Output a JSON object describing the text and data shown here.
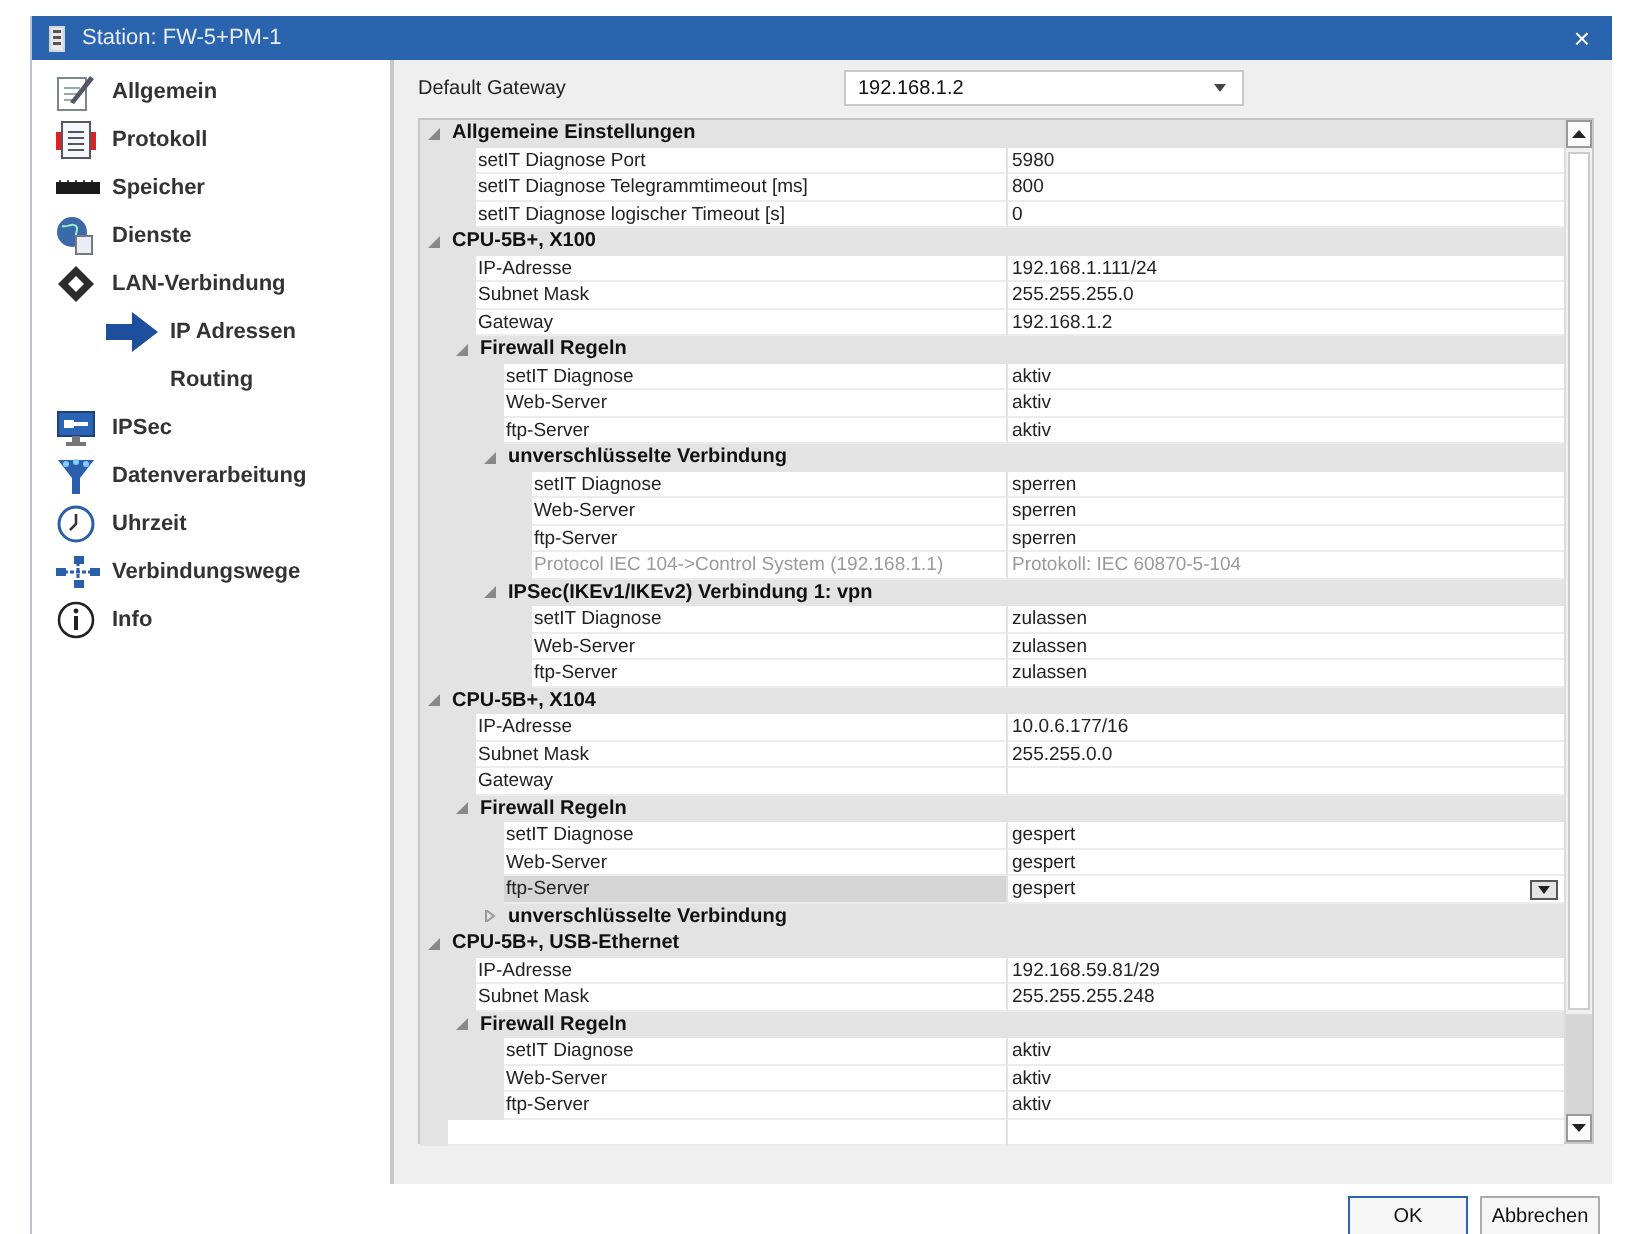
{
  "window": {
    "title": "Station: FW-5+PM-1",
    "close": "×"
  },
  "sidebar": {
    "items": [
      {
        "label": "Allgemein",
        "selected": false
      },
      {
        "label": "Protokoll",
        "selected": false
      },
      {
        "label": "Speicher",
        "selected": false
      },
      {
        "label": "Dienste",
        "selected": false
      },
      {
        "label": "LAN-Verbindung",
        "selected": false,
        "children": [
          {
            "label": "IP Adressen",
            "selected": true
          },
          {
            "label": "Routing",
            "selected": false
          }
        ]
      },
      {
        "label": "IPSec",
        "selected": false
      },
      {
        "label": "Datenverarbeitung",
        "selected": false
      },
      {
        "label": "Uhrzeit",
        "selected": false
      },
      {
        "label": "Verbindungswege",
        "selected": false
      },
      {
        "label": "Info",
        "selected": false
      }
    ]
  },
  "default_gateway": {
    "label": "Default Gateway",
    "value": "192.168.1.2"
  },
  "grid": {
    "groups": [
      {
        "title": "Allgemeine Einstellungen",
        "expanded": true,
        "children": [
          {
            "label": "setIT Diagnose Port",
            "value": "5980"
          },
          {
            "label": "setIT Diagnose Telegrammtimeout [ms]",
            "value": "800"
          },
          {
            "label": "setIT Diagnose logischer Timeout [s]",
            "value": "0"
          }
        ]
      },
      {
        "title": "CPU-5B+, X100",
        "expanded": true,
        "children": [
          {
            "label": "IP-Adresse",
            "value": "192.168.1.111/24"
          },
          {
            "label": "Subnet Mask",
            "value": "255.255.255.0"
          },
          {
            "label": "Gateway",
            "value": "192.168.1.2"
          },
          {
            "title": "Firewall Regeln",
            "expanded": true,
            "children": [
              {
                "label": "setIT Diagnose",
                "value": "aktiv"
              },
              {
                "label": "Web-Server",
                "value": "aktiv"
              },
              {
                "label": "ftp-Server",
                "value": "aktiv"
              },
              {
                "title": "unverschlüsselte Verbindung",
                "expanded": true,
                "children": [
                  {
                    "label": "setIT Diagnose",
                    "value": "sperren"
                  },
                  {
                    "label": "Web-Server",
                    "value": "sperren"
                  },
                  {
                    "label": "ftp-Server",
                    "value": "sperren"
                  },
                  {
                    "label": "Protocol IEC 104->Control System (192.168.1.1)",
                    "value": "Protokoll: IEC 60870-5-104",
                    "disabled": true
                  }
                ]
              },
              {
                "title": "IPSec(IKEv1/IKEv2) Verbindung 1: vpn",
                "expanded": true,
                "children": [
                  {
                    "label": "setIT Diagnose",
                    "value": "zulassen"
                  },
                  {
                    "label": "Web-Server",
                    "value": "zulassen"
                  },
                  {
                    "label": "ftp-Server",
                    "value": "zulassen"
                  }
                ]
              }
            ]
          }
        ]
      },
      {
        "title": "CPU-5B+, X104",
        "expanded": true,
        "children": [
          {
            "label": "IP-Adresse",
            "value": "10.0.6.177/16"
          },
          {
            "label": "Subnet Mask",
            "value": "255.255.0.0"
          },
          {
            "label": "Gateway"
          },
          {
            "title": "Firewall Regeln",
            "expanded": true,
            "children": [
              {
                "label": "setIT Diagnose",
                "value": "gespert"
              },
              {
                "label": "Web-Server",
                "value": "gespert"
              },
              {
                "label": "ftp-Server",
                "value": "gespert",
                "selected": true
              },
              {
                "title": "unverschlüsselte Verbindung",
                "expanded": false
              }
            ]
          }
        ]
      },
      {
        "title": "CPU-5B+, USB-Ethernet",
        "expanded": true,
        "children": [
          {
            "label": "IP-Adresse",
            "value": "192.168.59.81/29"
          },
          {
            "label": "Subnet Mask",
            "value": "255.255.255.248"
          },
          {
            "title": "Firewall Regeln",
            "expanded": true,
            "children": [
              {
                "label": "setIT Diagnose",
                "value": "aktiv"
              },
              {
                "label": "Web-Server",
                "value": "aktiv"
              },
              {
                "label": "ftp-Server",
                "value": "aktiv"
              }
            ]
          }
        ]
      }
    ]
  },
  "buttons": [
    {
      "label": "OK",
      "default": true
    },
    {
      "label": "Abbrechen",
      "default": false
    }
  ]
}
